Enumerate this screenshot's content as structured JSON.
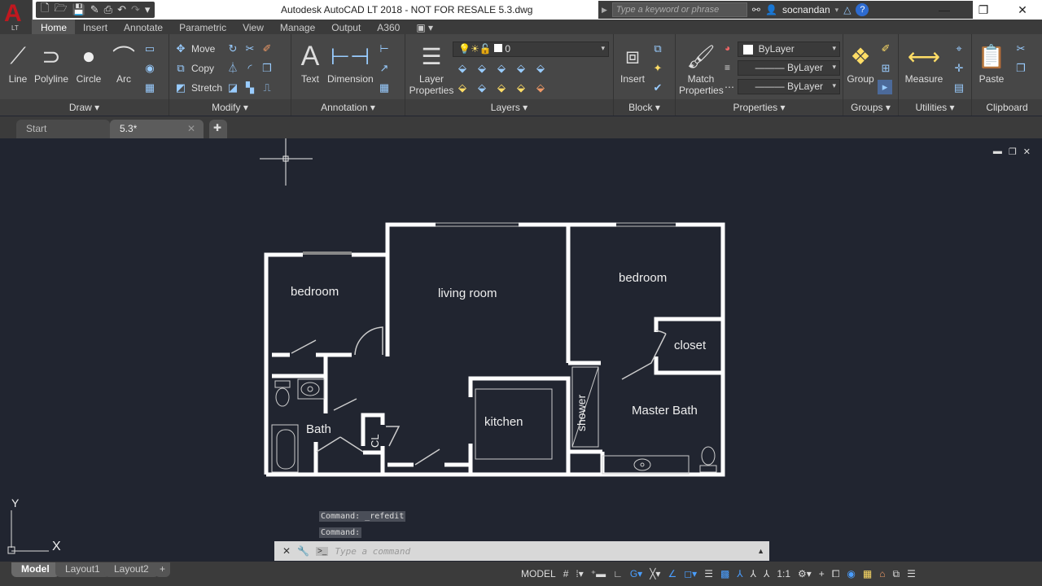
{
  "app": {
    "logo_letter": "A",
    "logo_sub": "LT",
    "title": "Autodesk AutoCAD LT 2018 - NOT FOR RESALE    5.3.dwg",
    "search_placeholder": "Type a keyword or phrase",
    "username": "socnandan",
    "window_controls": [
      "minimize",
      "restore",
      "close"
    ]
  },
  "quick_access": [
    "new-icon",
    "open-icon",
    "save-icon",
    "saveas-icon",
    "plot-icon",
    "undo-icon",
    "redo-icon",
    "customize-icon"
  ],
  "ribbon_tabs": [
    {
      "label": "Home",
      "active": true
    },
    {
      "label": "Insert"
    },
    {
      "label": "Annotate"
    },
    {
      "label": "Parametric"
    },
    {
      "label": "View"
    },
    {
      "label": "Manage"
    },
    {
      "label": "Output"
    },
    {
      "label": "A360"
    }
  ],
  "ribbon": {
    "draw": {
      "title": "Draw",
      "big": [
        "Line",
        "Polyline",
        "Circle",
        "Arc"
      ]
    },
    "modify": {
      "title": "Modify",
      "items": [
        "Move",
        "Copy",
        "Stretch"
      ]
    },
    "annotation": {
      "title": "Annotation",
      "big": [
        "Text",
        "Dimension"
      ]
    },
    "layers": {
      "title": "Layers",
      "big": "Layer Properties",
      "layer_value": "0"
    },
    "block": {
      "title": "Block",
      "big": "Insert"
    },
    "properties": {
      "title": "Properties",
      "big": "Match Properties",
      "color": "ByLayer",
      "linetype": "ByLayer",
      "lineweight": "ByLayer"
    },
    "groups": {
      "title": "Groups",
      "big": "Group"
    },
    "utilities": {
      "title": "Utilities",
      "big": "Measure"
    },
    "clipboard": {
      "title": "Clipboard",
      "big": "Paste"
    }
  },
  "doc_tabs": [
    {
      "label": "Start"
    },
    {
      "label": "5.3*",
      "active": true
    }
  ],
  "floorplan": {
    "rooms": [
      "bedroom",
      "living room",
      "bedroom",
      "closet",
      "Bath",
      "kitchen",
      "shower",
      "Master Bath",
      "CL"
    ]
  },
  "ucs": {
    "x": "X",
    "y": "Y"
  },
  "command": {
    "history": [
      "Command:  _refedit",
      "Command:"
    ],
    "placeholder": "Type a command"
  },
  "layout_tabs": [
    {
      "label": "Model",
      "active": true
    },
    {
      "label": "Layout1"
    },
    {
      "label": "Layout2"
    }
  ],
  "status_bar": {
    "mode": "MODEL",
    "scale": "1:1"
  }
}
